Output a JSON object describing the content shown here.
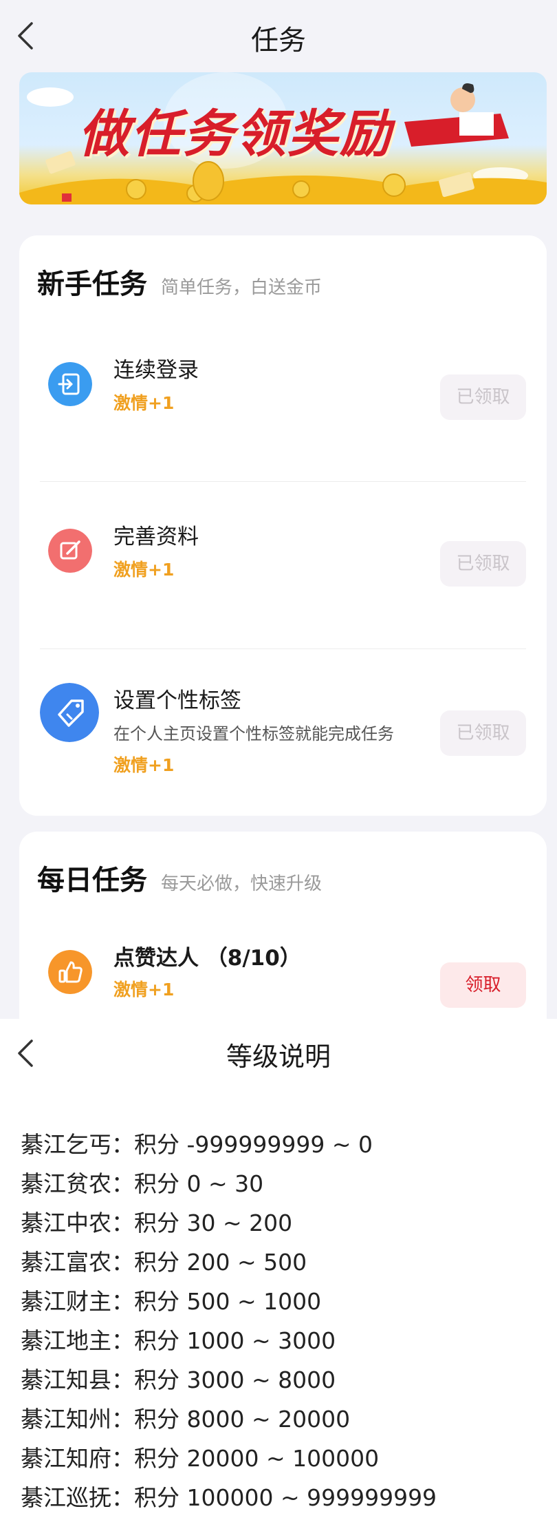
{
  "tasks_page": {
    "title": "任务",
    "banner_text": "做任务领奖励",
    "newbie": {
      "title": "新手任务",
      "subtitle": "简单任务，白送金币",
      "items": [
        {
          "name": "连续登录",
          "desc": "",
          "reward": "激情+1",
          "button": "已领取",
          "icon": "login-icon",
          "color": "#3a9cf0"
        },
        {
          "name": "完善资料",
          "desc": "",
          "reward": "激情+1",
          "button": "已领取",
          "icon": "edit-icon",
          "color": "#f26f6f"
        },
        {
          "name": "设置个性标签",
          "desc": "在个人主页设置个性标签就能完成任务",
          "reward": "激情+1",
          "button": "已领取",
          "icon": "tag-icon",
          "color": "#3f86ee"
        }
      ]
    },
    "daily": {
      "title": "每日任务",
      "subtitle": "每天必做，快速升级",
      "items": [
        {
          "name": "点赞达人  （8/10）",
          "reward": "激情+1",
          "button": "领取",
          "icon": "thumbs-up-icon",
          "color": "#f7962a"
        }
      ]
    }
  },
  "level_page": {
    "title": "等级说明",
    "levels": [
      "綦江乞丐：积分 -999999999 ~ 0",
      "綦江贫农：积分 0 ~ 30",
      "綦江中农：积分 30 ~ 200",
      "綦江富农：积分 200 ~ 500",
      "綦江财主：积分 500 ~ 1000",
      "綦江地主：积分 1000 ~ 3000",
      "綦江知县：积分 3000 ~ 8000",
      "綦江知州：积分 8000 ~ 20000",
      "綦江知府：积分 20000 ~ 100000",
      "綦江巡抚：积分 100000 ~ 999999999"
    ]
  },
  "colors": {
    "accent_red": "#d81e2a",
    "reward_orange": "#f0a020",
    "disabled_button_text": "#c9c4c9"
  }
}
